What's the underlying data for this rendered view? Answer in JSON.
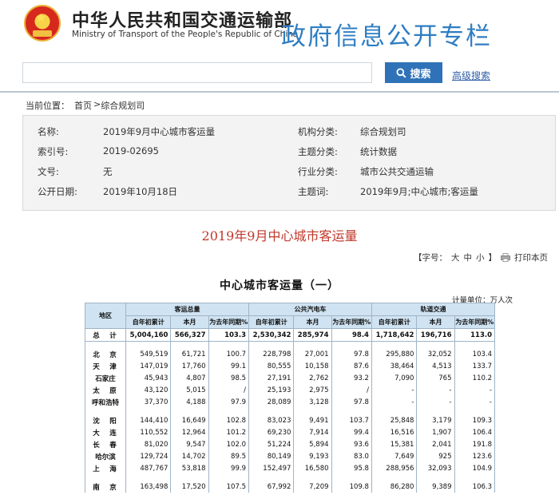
{
  "header": {
    "org_cn": "中华人民共和国交通运输部",
    "org_en": "Ministry of Transport of the People's Republic of China",
    "banner": "政府信息公开专栏",
    "emblem_icon": "national-emblem-icon"
  },
  "search": {
    "value": "",
    "button_label": "搜索",
    "advanced_link": "高级搜索",
    "button_color": "#2f72b8"
  },
  "breadcrumb": {
    "prefix": "当前位置：",
    "home": "首页",
    "sep": ">",
    "current": "综合规划司"
  },
  "meta": {
    "name_label": "名称:",
    "name_value": "2019年9月中心城市客运量",
    "org_label": "机构分类:",
    "org_value": "综合规划司",
    "index_label": "索引号:",
    "index_value": "2019-02695",
    "topic_label": "主题分类:",
    "topic_value": "统计数据",
    "docno_label": "文号:",
    "docno_value": "无",
    "industry_label": "行业分类:",
    "industry_value": "城市公共交通运输",
    "date_label": "公开日期:",
    "date_value": "2019年10月18日",
    "keywords_label": "主题词:",
    "keywords_value": "2019年9月;中心城市;客运量"
  },
  "doc_title": "2019年9月中心城市客运量",
  "toolbar": {
    "font_label": "【字号：",
    "large": "大",
    "medium": "中",
    "small": "小",
    "close": "】",
    "print_label": "打印本页"
  },
  "table": {
    "title": "中心城市客运量（一）",
    "unit": "计量单位：万人次",
    "header": {
      "region": "地区",
      "group1": "客运总量",
      "group2": "公共汽电车",
      "group3": "轨道交通",
      "ytd": "自年初累计",
      "month": "本月",
      "yoy": "为去年同期%"
    },
    "rows": [
      {
        "region": "总　计",
        "v": [
          "5,004,160",
          "566,327",
          "103.3",
          "2,530,342",
          "285,974",
          "98.4",
          "1,718,642",
          "196,716",
          "113.0"
        ]
      },
      {
        "region": "北　京",
        "v": [
          "549,519",
          "61,721",
          "100.7",
          "228,798",
          "27,001",
          "97.8",
          "295,880",
          "32,052",
          "103.4"
        ]
      },
      {
        "region": "天　津",
        "v": [
          "147,019",
          "17,760",
          "99.1",
          "80,555",
          "10,158",
          "87.6",
          "38,464",
          "4,513",
          "133.7"
        ]
      },
      {
        "region": "石家庄",
        "v": [
          "45,943",
          "4,807",
          "98.5",
          "27,191",
          "2,762",
          "93.2",
          "7,090",
          "765",
          "110.2"
        ]
      },
      {
        "region": "太　原",
        "v": [
          "43,120",
          "5,015",
          "/",
          "25,193",
          "2,975",
          "/",
          "-",
          "-",
          "-"
        ]
      },
      {
        "region": "呼和浩特",
        "v": [
          "37,370",
          "4,188",
          "97.9",
          "28,089",
          "3,128",
          "97.8",
          "-",
          "-",
          "-"
        ]
      },
      {
        "region": "沈　阳",
        "v": [
          "144,410",
          "16,649",
          "102.8",
          "83,023",
          "9,491",
          "103.7",
          "25,848",
          "3,179",
          "109.3"
        ]
      },
      {
        "region": "大　连",
        "v": [
          "110,552",
          "12,964",
          "101.2",
          "69,230",
          "7,914",
          "99.4",
          "16,516",
          "1,907",
          "106.4"
        ]
      },
      {
        "region": "长　春",
        "v": [
          "81,020",
          "9,547",
          "102.0",
          "51,224",
          "5,894",
          "93.6",
          "15,381",
          "2,041",
          "191.8"
        ]
      },
      {
        "region": "哈尔滨",
        "v": [
          "129,724",
          "14,702",
          "89.5",
          "80,149",
          "9,193",
          "83.0",
          "7,649",
          "925",
          "123.6"
        ]
      },
      {
        "region": "上　海",
        "v": [
          "487,767",
          "53,818",
          "99.9",
          "152,497",
          "16,580",
          "95.8",
          "288,956",
          "32,093",
          "104.9"
        ]
      },
      {
        "region": "南　京",
        "v": [
          "163,498",
          "17,520",
          "107.5",
          "67,992",
          "7,209",
          "109.8",
          "86,280",
          "9,389",
          "106.3"
        ]
      }
    ]
  }
}
